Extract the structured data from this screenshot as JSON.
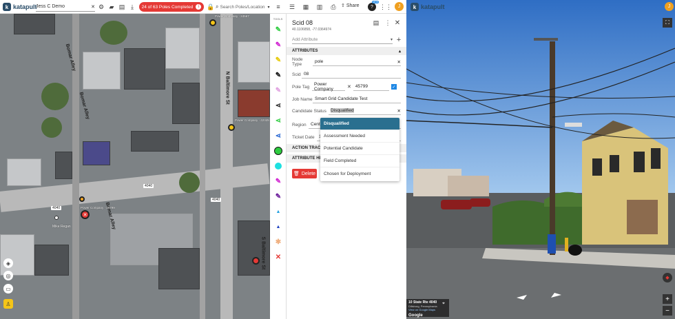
{
  "topbar": {
    "app_name": "katapult",
    "project_name": "Jess C Demo",
    "poles_completed": "24 of 63 Poles Completed",
    "search_placeholder": "Search Poles/Location",
    "share_label": "Share",
    "badge_new": "NEW",
    "user_initial": "J",
    "accent_color": "#e53935"
  },
  "map": {
    "street_labels": [
      "Bomar Alley",
      "Bomar Alley",
      "N Baltimore St",
      "S Baltimore St",
      "Bomar Alley"
    ],
    "pole_labels": [
      "Power Company · 24567",
      "Power Company · 42345",
      "Power Company · 45799"
    ],
    "number_labels": [
      "4040",
      "4040",
      "4040"
    ],
    "person_label": "Mike Regan"
  },
  "tools": {
    "header": "TOOLS"
  },
  "panel": {
    "title": "Scid 08",
    "coords": "40.1106858, -77.0364974",
    "add_attribute_placeholder": "Add Attribute",
    "attributes_header": "ATTRIBUTES",
    "fields": {
      "node_type_label": "Node Type",
      "node_type_value": "pole",
      "scid_label": "Scid",
      "scid_value": "08",
      "pole_tag_label": "Pole Tag",
      "pole_tag_company": "Power Company",
      "pole_tag_value": "45799",
      "job_name_label": "Job Name",
      "job_name_value": "Smart Grid Candidate Test",
      "candidate_status_label": "Candidate Status",
      "candidate_status_value": "Disqualified",
      "region_label": "Region",
      "region_value": "Centr",
      "ticket_date_label": "Ticket Date",
      "ticket_date_value": "1"
    },
    "action_tracker": "ACTION TRACKER",
    "attribute_history": "ATTRIBUTE HISTORY",
    "delete_label": "Delete",
    "dropdown_options": [
      "Disqualified",
      "Assessment Needed",
      "Potential Candidate",
      "Field Completed",
      "Chosen for Deployment"
    ],
    "dropdown_selected": "Disqualified"
  },
  "streetview": {
    "address": "10 State Rte 4040",
    "city": "Dillsburg, Pennsylvania",
    "link": "View on Google Maps",
    "google": "Google"
  }
}
